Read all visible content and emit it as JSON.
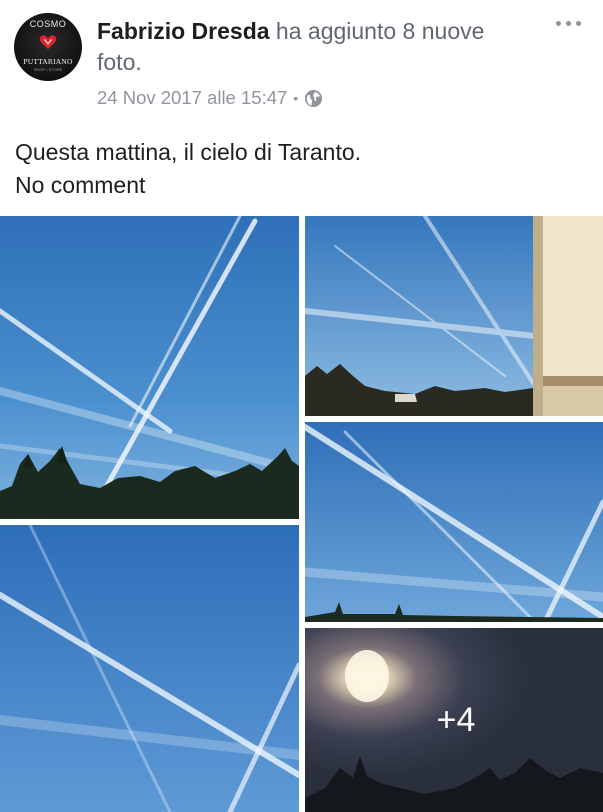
{
  "post": {
    "avatar": {
      "icon": "heart-logo-icon",
      "logo_top_text": "COSMO",
      "logo_bottom_text": "PUTTARIANO",
      "logo_tiny_text": "SHOP • STORE"
    },
    "author": "Fabrizio Dresda",
    "action": " ha aggiunto 8 nuove foto.",
    "timestamp": "24 Nov 2017 alle 15:47",
    "separator": "•",
    "audience_icon": "globe-icon",
    "menu_icon": "more-options-icon",
    "caption_lines": [
      "Questa mattina, il cielo di Taranto.",
      "No comment"
    ]
  },
  "photos": {
    "count": 5,
    "extra_count_label": "+4",
    "extra_count": 4,
    "subjects": [
      "sky-contrails",
      "sky-contrails-building",
      "sky-contrails",
      "sky-contrails",
      "sky-sun"
    ]
  },
  "colors": {
    "author": "#1c1e21",
    "secondary_text": "#606770",
    "meta_text": "#90949c",
    "sky": "#3f86c8"
  }
}
